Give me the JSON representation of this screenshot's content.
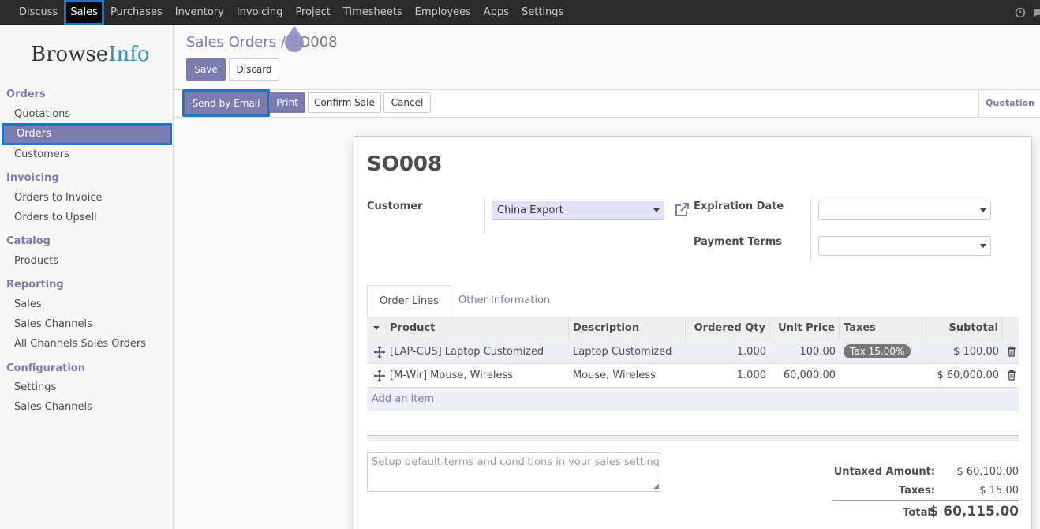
{
  "navbar": {
    "items": [
      "Discuss",
      "Sales",
      "Purchases",
      "Inventory",
      "Invoicing",
      "Project",
      "Timesheets",
      "Employees",
      "Apps",
      "Settings"
    ],
    "active": "Sales"
  },
  "logo": {
    "part1": "Browse",
    "part2": "Info"
  },
  "sidebar": {
    "orders_header": "Orders",
    "quotations": "Quotations",
    "orders": "Orders",
    "customers": "Customers",
    "invoicing_header": "Invoicing",
    "orders_to_invoice": "Orders to Invoice",
    "orders_to_upsell": "Orders to Upsell",
    "catalog_header": "Catalog",
    "products": "Products",
    "reporting_header": "Reporting",
    "rep_sales": "Sales",
    "rep_sales_channels": "Sales Channels",
    "rep_all_channels": "All Channels Sales Orders",
    "configuration_header": "Configuration",
    "conf_settings": "Settings",
    "conf_sales_channels": "Sales Channels"
  },
  "breadcrumb": {
    "parent": "Sales Orders",
    "separator": " / ",
    "current": "SO008"
  },
  "buttons": {
    "save": "Save",
    "discard": "Discard",
    "send_by_email": "Send by Email",
    "print": "Print",
    "confirm_sale": "Confirm Sale",
    "cancel": "Cancel"
  },
  "status": {
    "current": "Quotation"
  },
  "form": {
    "title": "SO008",
    "customer_label": "Customer",
    "customer_value": "China Export",
    "expiration_label": "Expiration Date",
    "expiration_value": "",
    "payment_terms_label": "Payment Terms",
    "payment_terms_value": ""
  },
  "tabs": {
    "order_lines": "Order Lines",
    "other_info": "Other Information"
  },
  "table": {
    "headers": {
      "product": "Product",
      "description": "Description",
      "ordered_qty": "Ordered Qty",
      "unit_price": "Unit Price",
      "taxes": "Taxes",
      "subtotal": "Subtotal"
    },
    "rows": [
      {
        "product": "[LAP-CUS] Laptop Customized",
        "description": "Laptop Customized",
        "qty": "1.000",
        "unit_price": "100.00",
        "taxes": "Tax 15.00%",
        "subtotal": "$ 100.00"
      },
      {
        "product": "[M-Wir] Mouse, Wireless",
        "description": "Mouse, Wireless",
        "qty": "1.000",
        "unit_price": "60,000.00",
        "taxes": "",
        "subtotal": "$ 60,000.00"
      }
    ],
    "add_item": "Add an item"
  },
  "notes_placeholder": "Setup default terms and conditions in your sales settings ...",
  "totals": {
    "untaxed_label": "Untaxed Amount:",
    "untaxed_value": "$ 60,100.00",
    "taxes_label": "Taxes:",
    "taxes_value": "$ 15.00",
    "total_label": "Total:",
    "total_value": "$ 60,115.00"
  },
  "colors": {
    "accent": "#7c7bad",
    "highlight_border": "#1b75c8",
    "navbar": "#2b2b2b"
  },
  "icons": [
    "clock-icon",
    "chat-icon",
    "external-link-icon",
    "move-handle-icon",
    "trash-icon",
    "sort-caret-icon",
    "dropdown-caret-icon"
  ]
}
